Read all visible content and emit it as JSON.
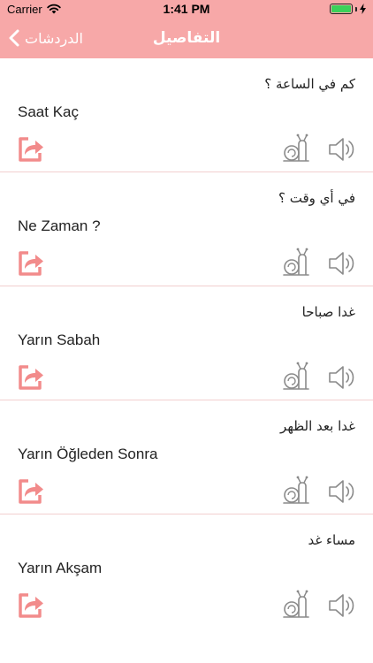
{
  "status_bar": {
    "carrier": "Carrier",
    "time": "1:41 PM"
  },
  "nav": {
    "back_label": "الدردشات",
    "title": "التفاصيل"
  },
  "colors": {
    "accent": "#f7a8a8",
    "icon_pink": "#f28b8b",
    "icon_gray": "#8a8a8a",
    "divider": "#f2cfcf"
  },
  "icons": {
    "share": "share-icon",
    "slow": "snail-icon",
    "audio": "speaker-icon"
  },
  "phrases": [
    {
      "arabic": "كم في الساعة ؟",
      "turkish": "Saat Kaç"
    },
    {
      "arabic": "في أي وقت ؟",
      "turkish": "Ne Zaman ?"
    },
    {
      "arabic": "غدا صباحا",
      "turkish": "Yarın Sabah"
    },
    {
      "arabic": "غدا بعد الظهر",
      "turkish": "Yarın Öğleden Sonra"
    },
    {
      "arabic": "مساء غد",
      "turkish": "Yarın Akşam"
    }
  ]
}
